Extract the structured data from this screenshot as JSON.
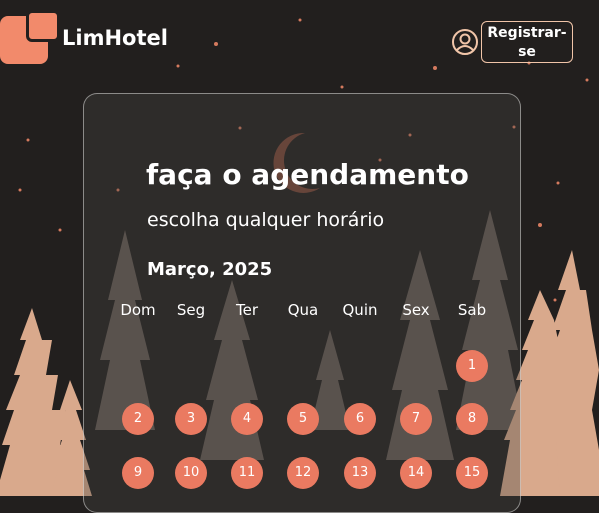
{
  "header": {
    "brand": "LimHotel",
    "register_label": "Registrar-se"
  },
  "booking": {
    "title": "faça o agendamento",
    "subtitle": "escolha qualquer horário",
    "month": "Março, 2025",
    "weekdays": [
      "Dom",
      "Seg",
      "Ter",
      "Qua",
      "Quin",
      "Sex",
      "Sab"
    ],
    "days": [
      {
        "day": "1",
        "weekday_index": 6,
        "week": 0
      },
      {
        "day": "2",
        "weekday_index": 0,
        "week": 1
      },
      {
        "day": "3",
        "weekday_index": 1,
        "week": 1
      },
      {
        "day": "4",
        "weekday_index": 2,
        "week": 1
      },
      {
        "day": "5",
        "weekday_index": 3,
        "week": 1
      },
      {
        "day": "6",
        "weekday_index": 4,
        "week": 1
      },
      {
        "day": "7",
        "weekday_index": 5,
        "week": 1
      },
      {
        "day": "8",
        "weekday_index": 6,
        "week": 1
      },
      {
        "day": "9",
        "weekday_index": 0,
        "week": 2
      },
      {
        "day": "10",
        "weekday_index": 1,
        "week": 2
      },
      {
        "day": "11",
        "weekday_index": 2,
        "week": 2
      },
      {
        "day": "12",
        "weekday_index": 3,
        "week": 2
      },
      {
        "day": "13",
        "weekday_index": 4,
        "week": 2
      },
      {
        "day": "14",
        "weekday_index": 5,
        "week": 2
      },
      {
        "day": "15",
        "weekday_index": 6,
        "week": 2
      }
    ]
  },
  "colors": {
    "accent": "#ea7a61",
    "background": "#221f1e",
    "tree": "#d9a98c"
  },
  "icons": {
    "logo": "logo-icon",
    "user": "user-circle-icon"
  }
}
